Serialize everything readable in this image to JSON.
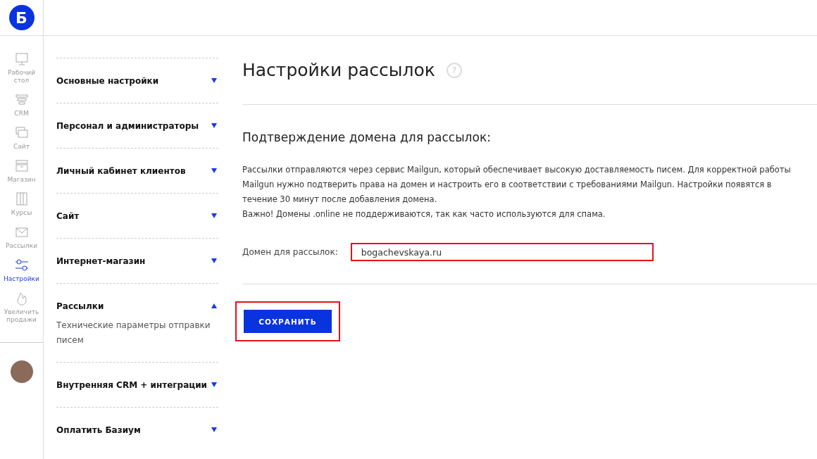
{
  "logo": {
    "letter": "Б"
  },
  "rail": [
    {
      "label": "Рабочий стол",
      "selected": false
    },
    {
      "label": "CRM",
      "selected": false
    },
    {
      "label": "Сайт",
      "selected": false
    },
    {
      "label": "Магазин",
      "selected": false
    },
    {
      "label": "Курсы",
      "selected": false
    },
    {
      "label": "Рассылки",
      "selected": false
    },
    {
      "label": "Настройки",
      "selected": true
    },
    {
      "label": "Увеличить продажи",
      "selected": false
    }
  ],
  "menu": [
    {
      "title": "Основные настройки",
      "expanded": false
    },
    {
      "title": "Персонал и администраторы",
      "expanded": false
    },
    {
      "title": "Личный кабинет клиентов",
      "expanded": false
    },
    {
      "title": "Сайт",
      "expanded": false
    },
    {
      "title": "Интернет-магазин",
      "expanded": false
    },
    {
      "title": "Рассылки",
      "expanded": true,
      "children": [
        "Технические параметры отправки писем"
      ]
    },
    {
      "title": "Внутренняя CRM + интеграции",
      "expanded": false
    },
    {
      "title": "Оплатить Базиум",
      "expanded": false
    }
  ],
  "page": {
    "title": "Настройки рассылок",
    "help": "?",
    "section_title": "Подтверждение домена для рассылок:",
    "paragraphs": [
      "Рассылки отправляются через сервис Mailgun, который обеспечивает высокую доставляемость писем. Для корректной работы Mailgun нужно подтверить права на домен и настроить его в соответствии с требованиями Mailgun. Настройки появятся в течение 30 минут после добавления домена.",
      "Важно! Домены .online не поддерживаются, так как часто используются для спама."
    ],
    "domain_field": {
      "label": "Домен для рассылок:",
      "value": "bogachevskaya.ru",
      "highlighted": true
    },
    "save_button": {
      "label": "СОХРАНИТЬ",
      "highlighted": true
    }
  }
}
